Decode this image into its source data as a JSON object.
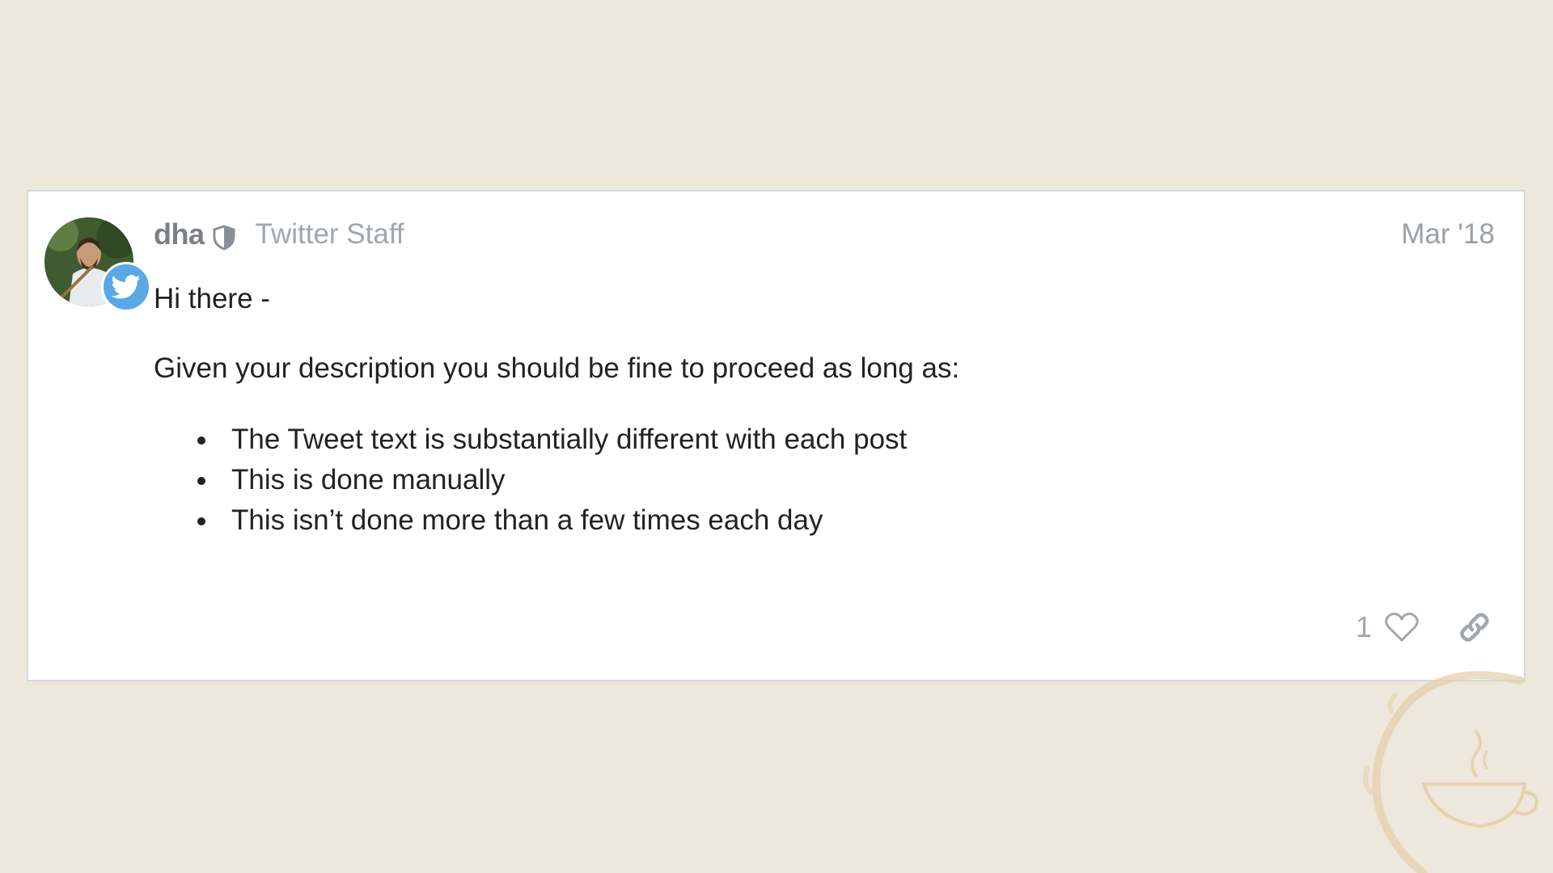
{
  "post": {
    "author": {
      "username": "dha",
      "title": "Twitter Staff",
      "avatar_icon": "user-photo",
      "badge_icon": "twitter-bird-icon",
      "role_icon": "shield-icon"
    },
    "date": "Mar '18",
    "body": {
      "greeting": "Hi there -",
      "intro": "Given your description you should be fine to proceed as long as:",
      "conditions": [
        "The Tweet text is substantially different with each post",
        "This is done manually",
        "This isn’t done more than a few times each day"
      ]
    },
    "actions": {
      "like_count": "1",
      "like_icon": "heart-icon",
      "share_icon": "link-icon"
    }
  },
  "colors": {
    "background": "#ede7dc",
    "twitter_blue": "#5aa8e6",
    "muted_text": "#a1a7ad",
    "body_text": "#222222"
  }
}
